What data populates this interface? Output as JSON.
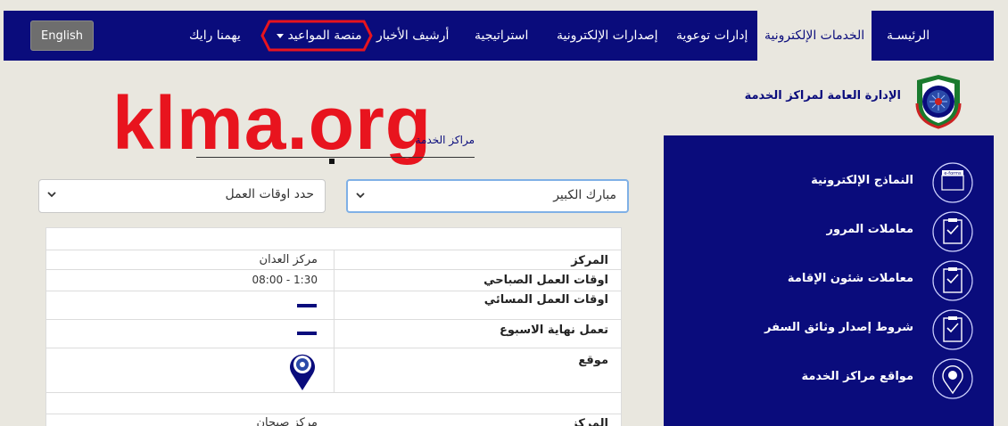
{
  "nav": {
    "items": [
      {
        "label": "الرئيسـة"
      },
      {
        "label": "الخدمات الإلكترونية"
      },
      {
        "label": "إدارات توعوية"
      },
      {
        "label": "إصدارات الإلكترونية"
      },
      {
        "label": "استراتيجية"
      },
      {
        "label": "أرشيف الأخبار"
      },
      {
        "label": "منصة المواعيد"
      },
      {
        "label": "يهمنا رايك"
      }
    ],
    "english_label": "English"
  },
  "header": {
    "dept_title": "الإدارة العامة لمراكز الخدمة"
  },
  "watermark": "klma.org",
  "centers_heading": "مراكز الخدمة",
  "filters": {
    "region_value": "مبارك الكبير",
    "hours_value": "حدد اوقات العمل"
  },
  "table": {
    "labels": {
      "center": "المركز",
      "morning": "اوقات العمل الصباحي",
      "evening": "اوقات العمل المسائي",
      "weekend": "تعمل نهاية الاسبوع",
      "location": "موقع"
    },
    "rows": [
      {
        "center": "مركز العدان",
        "morning": "08:00 - 1:30"
      },
      {
        "center": "مركز صبحان"
      }
    ]
  },
  "side": {
    "items": [
      {
        "label": "النماذج الإلكترونية",
        "icon": "e-forms-icon",
        "icon_text": "e-forms"
      },
      {
        "label": "معاملات المرور",
        "icon": "clipboard-check-icon"
      },
      {
        "label": "معاملات شئون الإقامة",
        "icon": "clipboard-check-icon"
      },
      {
        "label": "شروط إصدار وثائق السفر",
        "icon": "clipboard-check-icon"
      },
      {
        "label": "مواقع مراكز الخدمة",
        "icon": "location-pin-icon"
      }
    ]
  },
  "colors": {
    "navy": "#0a0c7c",
    "watermark_red": "#e8141e",
    "background": "#e9e7df"
  }
}
